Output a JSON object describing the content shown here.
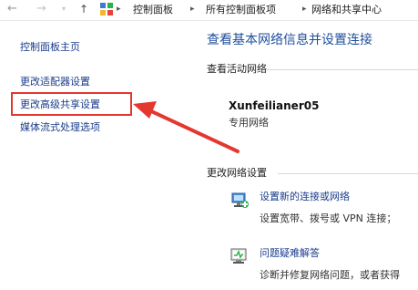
{
  "address_bar": {
    "back_icon": "back-arrow-icon",
    "forward_icon": "forward-arrow-icon",
    "up_icon": "up-arrow-icon",
    "location_icon": "control-panel-icon",
    "breadcrumbs": [
      "控制面板",
      "所有控制面板项",
      "网络和共享中心"
    ]
  },
  "sidebar": {
    "items": [
      {
        "label": "控制面板主页"
      },
      {
        "label": "更改适配器设置"
      },
      {
        "label": "更改高级共享设置"
      },
      {
        "label": "媒体流式处理选项"
      }
    ]
  },
  "main": {
    "title": "查看基本网络信息并设置连接",
    "active_section": "查看活动网络",
    "network": {
      "name": "Xunfeilianer05",
      "type": "专用网络"
    },
    "change_section": "更改网络设置",
    "tasks": [
      {
        "icon": "new-connection-icon",
        "title": "设置新的连接或网络",
        "desc": "设置宽带、拨号或 VPN 连接；"
      },
      {
        "icon": "troubleshoot-icon",
        "title": "问题疑难解答",
        "desc": "诊断并修复网络问题，或者获得"
      }
    ]
  },
  "annotation": {
    "color": "#e4372f"
  }
}
